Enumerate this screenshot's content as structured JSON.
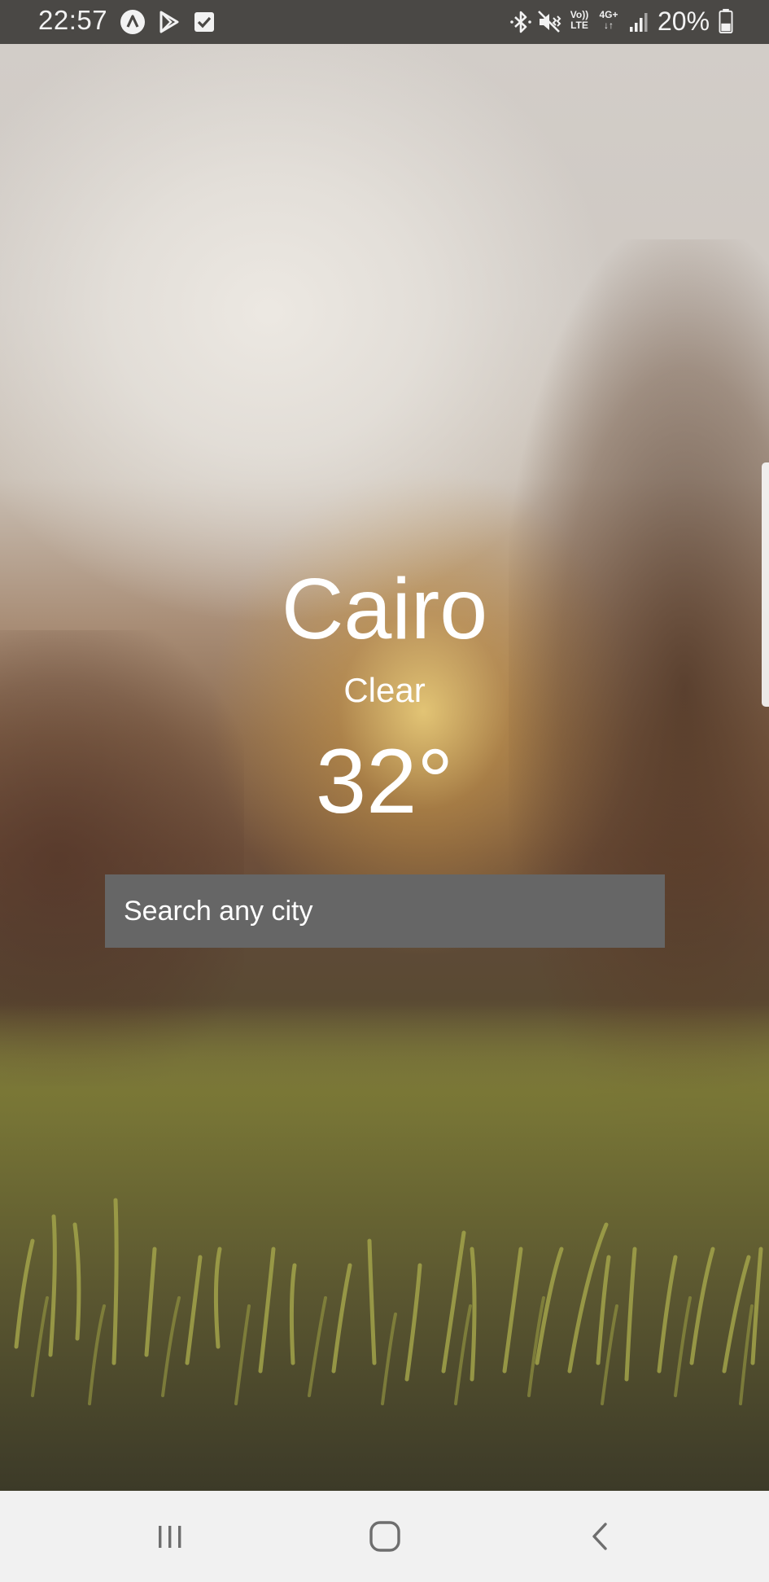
{
  "status_bar": {
    "time": "22:57",
    "left_icons": [
      "app-a-icon",
      "play-store-icon",
      "checkbox-icon"
    ],
    "right_icons": [
      "bluetooth-icon",
      "vibrate-mute-icon",
      "volte-icon",
      "4g-plus-icon",
      "signal-icon",
      "battery-icon"
    ],
    "volte_label_top": "Vo))",
    "volte_label_bottom": "LTE",
    "network_label": "4G+",
    "battery_percent": "20%"
  },
  "weather": {
    "city": "Cairo",
    "condition": "Clear",
    "temperature": "32°"
  },
  "search": {
    "placeholder": "Search any city",
    "value": ""
  },
  "nav_bar": {
    "buttons": [
      "recent-apps-icon",
      "home-icon",
      "back-icon"
    ]
  }
}
